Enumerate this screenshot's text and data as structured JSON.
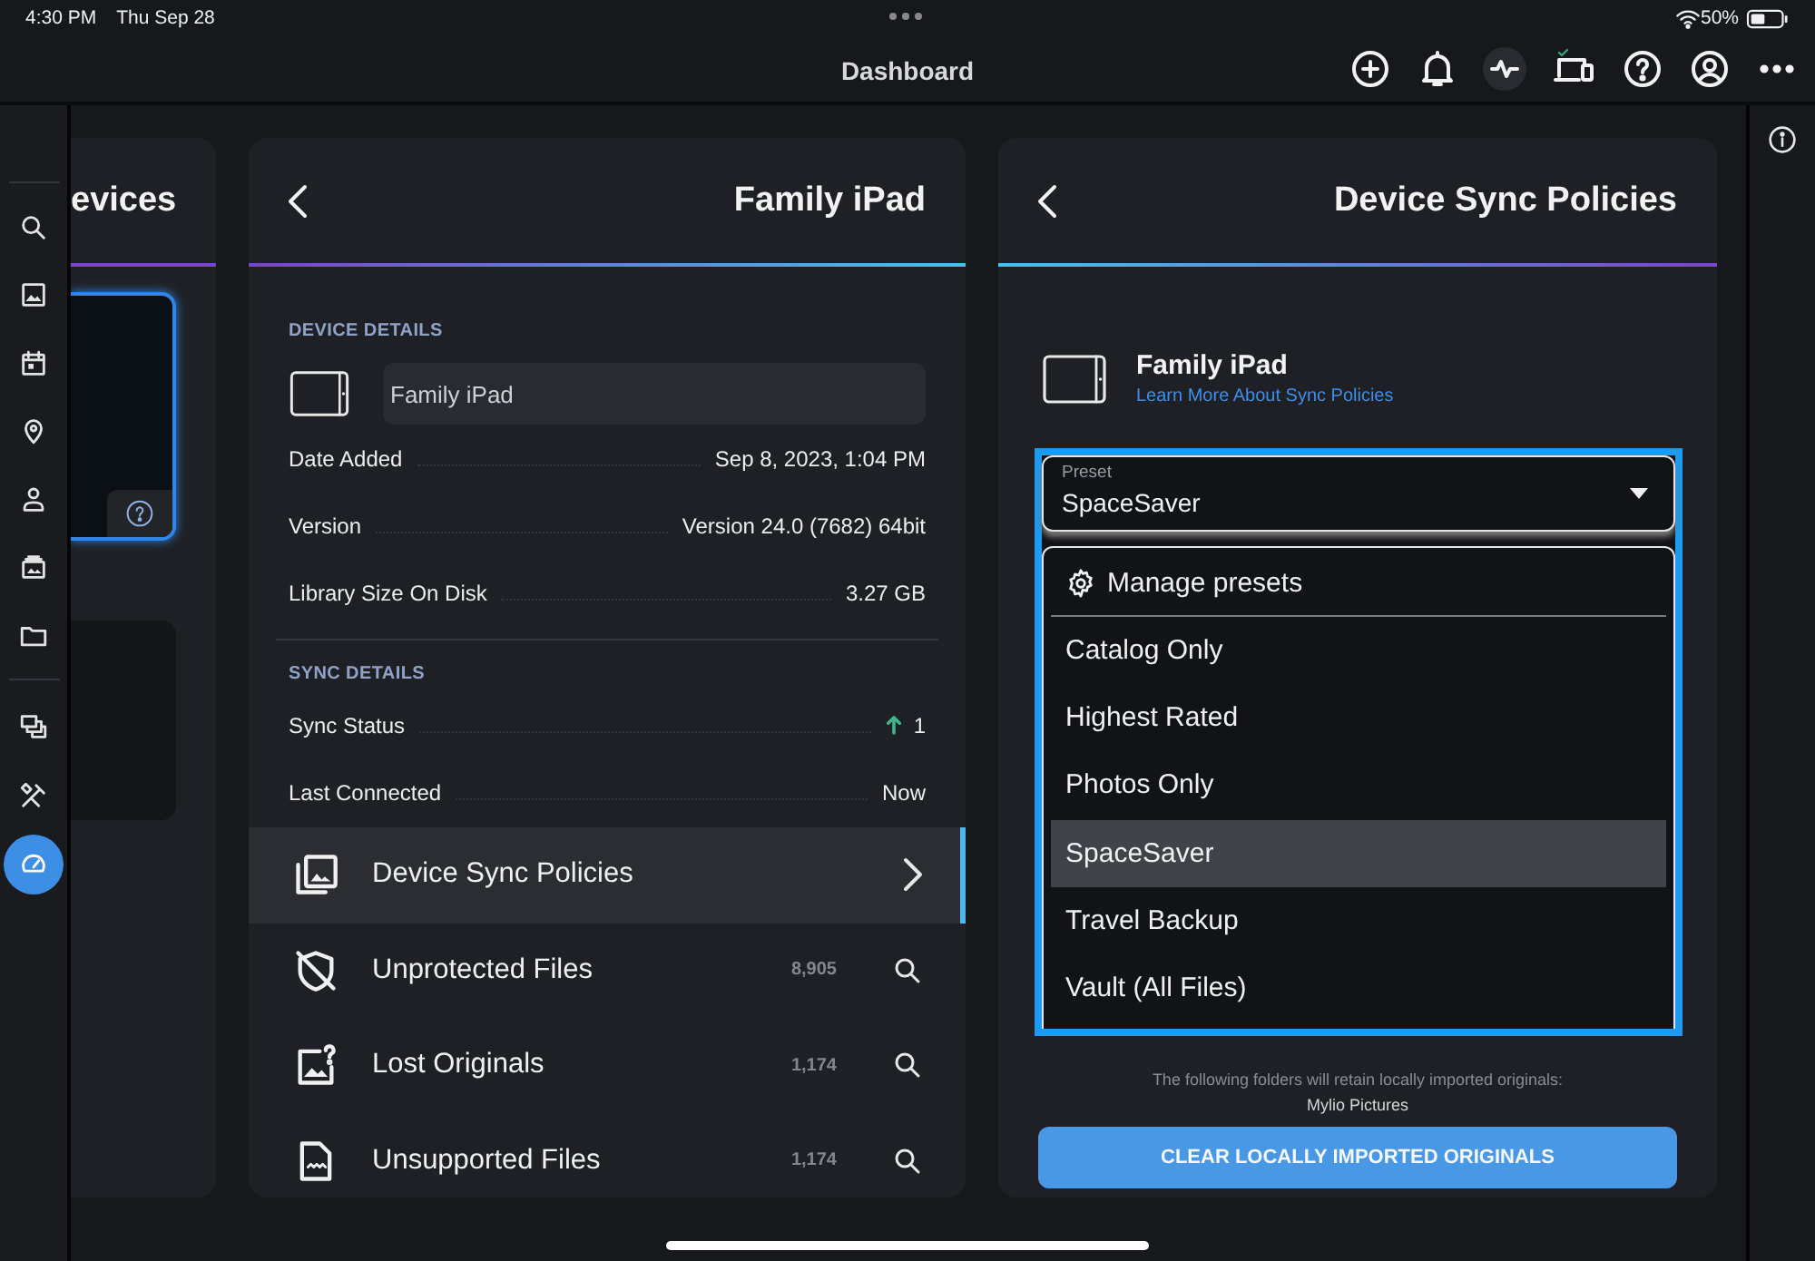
{
  "status_bar": {
    "time": "4:30 PM",
    "date": "Thu Sep 28",
    "battery": "50%"
  },
  "title_bar": {
    "title": "Dashboard"
  },
  "sidebar": {
    "items": [
      {
        "selected": false
      },
      {
        "selected": false
      },
      {
        "selected": false
      },
      {
        "selected": false
      },
      {
        "selected": false
      },
      {
        "selected": false
      },
      {
        "selected": false
      },
      {
        "selected": false
      },
      {
        "selected": false
      },
      {
        "selected": true
      }
    ]
  },
  "devices_panel": {
    "title": "evices"
  },
  "detail_panel": {
    "title": "Family iPad",
    "device_heading": "DEVICE DETAILS",
    "device_name": "Family iPad",
    "details": [
      {
        "label": "Date Added",
        "value": "Sep 8, 2023, 1:04 PM"
      },
      {
        "label": "Version",
        "value": "Version 24.0 (7682) 64bit"
      },
      {
        "label": "Library Size On Disk",
        "value": "3.27 GB"
      }
    ],
    "sync_heading": "SYNC DETAILS",
    "sync_details": [
      {
        "label": "Sync Status",
        "value": "1",
        "kind": "upload"
      },
      {
        "label": "Last Connected",
        "value": "Now"
      }
    ],
    "nav_items": [
      {
        "label": "Device Sync Policies",
        "kind": "link",
        "selected": true
      },
      {
        "label": "Unprotected Files",
        "count": "8,905",
        "kind": "search",
        "selected": false
      },
      {
        "label": "Lost Originals",
        "count": "1,174",
        "kind": "search",
        "selected": false
      },
      {
        "label": "Unsupported Files",
        "count": "1,174",
        "kind": "search",
        "selected": false
      }
    ]
  },
  "sync_panel": {
    "title": "Device Sync Policies",
    "device_name": "Family iPad",
    "link": "Learn More About Sync Policies",
    "preset": {
      "label": "Preset",
      "value": "SpaceSaver",
      "expanded": true
    },
    "manage": "Manage presets",
    "options": [
      {
        "label": "Catalog Only",
        "selected": false
      },
      {
        "label": "Highest Rated",
        "selected": false
      },
      {
        "label": "Photos Only",
        "selected": false
      },
      {
        "label": "SpaceSaver",
        "selected": true
      },
      {
        "label": "Travel Backup",
        "selected": false
      },
      {
        "label": "Vault (All Files)",
        "selected": false
      }
    ],
    "note": "The following folders will retain locally imported originals:",
    "folder": "Mylio Pictures",
    "button": "CLEAR LOCALLY IMPORTED ORIGINALS"
  }
}
